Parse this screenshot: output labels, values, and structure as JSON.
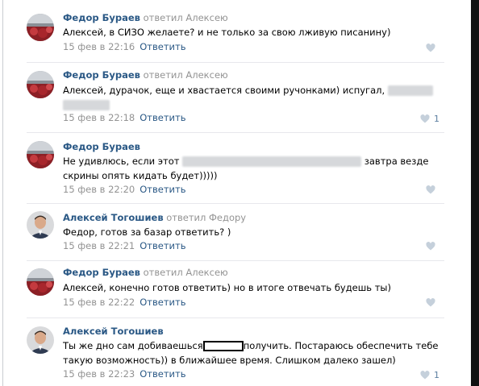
{
  "comments": [
    {
      "author": "Федор Бураев",
      "reply_to": "ответил Алексею",
      "text_1": "Алексей, в СИЗО желаете? и не только за свою лживую писанину)",
      "date": "15 фев в 22:16",
      "reply_label": "Ответить",
      "likes": ""
    },
    {
      "author": "Федор Бураев",
      "reply_to": "ответил Алексею",
      "text_1": "Алексей, дурачок, еще и хвастается своими ручонками) испугал,",
      "date": "15 фев в 22:18",
      "reply_label": "Ответить",
      "likes": "1"
    },
    {
      "author": "Федор Бураев",
      "reply_to": "",
      "text_1": "Не удивлюсь, если этот",
      "text_2": "завтра везде",
      "text_3": "скрины опять кидать будет)))))",
      "date": "15 фев в 22:20",
      "reply_label": "Ответить",
      "likes": ""
    },
    {
      "author": "Алексей Тогошиев",
      "reply_to": "ответил Федору",
      "text_1": "Федор, готов за базар ответить? )",
      "date": "15 фев в 22:21",
      "reply_label": "Ответить",
      "likes": ""
    },
    {
      "author": "Федор Бураев",
      "reply_to": "ответил Алексею",
      "text_1": "Алексей, конечно готов ответить) но в итоге отвечать будешь ты)",
      "date": "15 фев в 22:22",
      "reply_label": "Ответить",
      "likes": ""
    },
    {
      "author": "Алексей Тогошиев",
      "reply_to": "",
      "text_1": "Ты же дно сам добиваешься",
      "text_2": "получить. Постараюсь обеспечить тебе",
      "text_3": "такую возможность)) в ближайшее время. Слишком далеко зашел)",
      "date": "15 фев в 22:23",
      "reply_label": "Ответить",
      "likes": "1"
    }
  ],
  "colors": {
    "link": "#2a5885",
    "muted": "#939393",
    "separator": "#e7e8ec",
    "like_icon": "#c5d0db"
  },
  "icons": {
    "like": "heart-icon"
  }
}
